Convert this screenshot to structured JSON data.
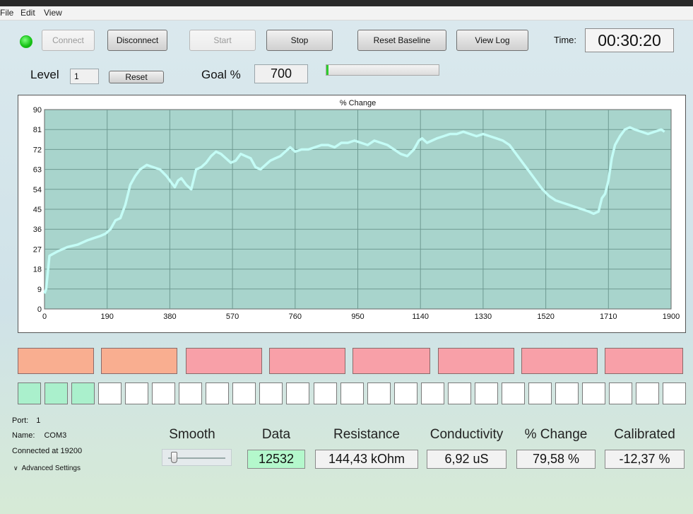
{
  "menu": [
    "File",
    "Edit",
    "View"
  ],
  "toolbar": {
    "connect": "Connect",
    "disconnect": "Disconnect",
    "start": "Start",
    "stop": "Stop",
    "reset_baseline": "Reset Baseline",
    "view_log": "View Log",
    "time_label": "Time:",
    "time_value": "00:30:20"
  },
  "status_led_color": "#19c419",
  "level": {
    "label": "Level",
    "value": "1",
    "reset": "Reset"
  },
  "goal": {
    "label": "Goal %",
    "value": "700",
    "progress": 0.02
  },
  "chart_data": {
    "type": "line",
    "title": "% Change",
    "xlim": [
      0,
      1900
    ],
    "ylim": [
      0,
      90
    ],
    "xticks": [
      0,
      190,
      380,
      570,
      760,
      950,
      1140,
      1330,
      1520,
      1710,
      1900
    ],
    "yticks": [
      0,
      9,
      18,
      27,
      36,
      45,
      54,
      63,
      72,
      81,
      90
    ],
    "grid": true,
    "line_color": "#c4fcf6",
    "plot_bg": "#a8d4cc",
    "series": [
      {
        "x": [
          0,
          5,
          15,
          40,
          70,
          100,
          130,
          150,
          170,
          185,
          200,
          215,
          230,
          245,
          260,
          275,
          290,
          310,
          330,
          350,
          370,
          385,
          395,
          405,
          415,
          430,
          445,
          460,
          475,
          490,
          505,
          520,
          535,
          550,
          565,
          580,
          595,
          610,
          625,
          640,
          655,
          670,
          685,
          700,
          715,
          730,
          745,
          760,
          780,
          800,
          820,
          840,
          860,
          880,
          900,
          920,
          940,
          960,
          980,
          1000,
          1020,
          1040,
          1060,
          1080,
          1100,
          1120,
          1135,
          1145,
          1160,
          1175,
          1190,
          1210,
          1230,
          1250,
          1270,
          1290,
          1310,
          1330,
          1350,
          1370,
          1390,
          1410,
          1430,
          1450,
          1470,
          1490,
          1510,
          1530,
          1550,
          1570,
          1590,
          1610,
          1630,
          1650,
          1665,
          1680,
          1690,
          1700,
          1710,
          1720,
          1730,
          1745,
          1760,
          1775,
          1790,
          1810,
          1830,
          1850,
          1870,
          1880
        ],
        "y": [
          7,
          9,
          24,
          26,
          28,
          29,
          31,
          32,
          33,
          34,
          36,
          40,
          41,
          47,
          56,
          60,
          63,
          65,
          64,
          63,
          60,
          57,
          55,
          58,
          59,
          56,
          54,
          63,
          64,
          66,
          69,
          71,
          70,
          68,
          66,
          67,
          70,
          69,
          68,
          64,
          63,
          65,
          67,
          68,
          69,
          71,
          73,
          71,
          72,
          72,
          73,
          74,
          74,
          73,
          75,
          75,
          76,
          75,
          74,
          76,
          75,
          74,
          72,
          70,
          69,
          72,
          76,
          77,
          75,
          76,
          77,
          78,
          79,
          79,
          80,
          79,
          78,
          79,
          78,
          77,
          76,
          74,
          70,
          66,
          62,
          58,
          54,
          51,
          49,
          48,
          47,
          46,
          45,
          44,
          43,
          44,
          50,
          52,
          58,
          68,
          74,
          78,
          81,
          82,
          81,
          80,
          79,
          80,
          81,
          80
        ]
      }
    ]
  },
  "indicators": {
    "rect_colors": [
      "#f9ae90",
      "#f9ae90",
      "#f8a0a8",
      "#f8a0a8",
      "#f8a0a8",
      "#f8a0a8",
      "#f8a0a8",
      "#f8a0a8"
    ],
    "squares_total": 25,
    "squares_on": 3
  },
  "port": {
    "port_label": "Port:",
    "port_value": "1",
    "name_label": "Name:",
    "name_value": "COM3",
    "connected": "Connected at 19200",
    "advanced": "Advanced Settings"
  },
  "readouts": {
    "smooth_label": "Smooth",
    "smooth_value": 0.05,
    "data_label": "Data",
    "data_value": "12532",
    "resistance_label": "Resistance",
    "resistance_value": "144,43 kOhm",
    "conductivity_label": "Conductivity",
    "conductivity_value": "6,92 uS",
    "change_label": "% Change",
    "change_value": "79,58 %",
    "calibrated_label": "Calibrated",
    "calibrated_value": "-12,37 %"
  }
}
